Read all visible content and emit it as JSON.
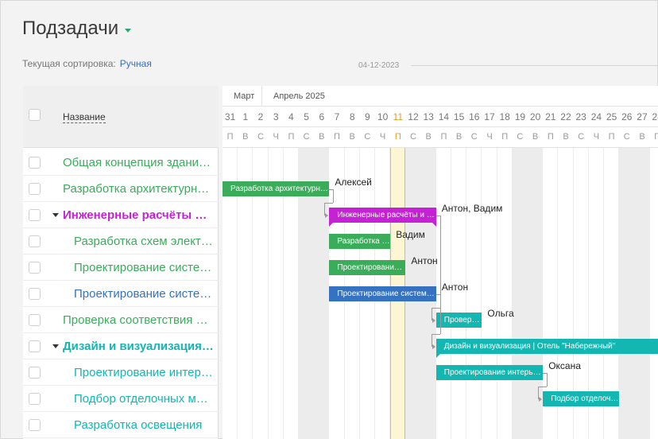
{
  "page": {
    "title": "Подзадачи"
  },
  "sort": {
    "label": "Текущая сортировка:",
    "value": "Ручная"
  },
  "timeline_date": "04-12-2023",
  "colors": {
    "green": "#3aac5a",
    "magenta": "#c522d6",
    "blue": "#3572c1",
    "teal": "#14b6b2",
    "link": "#3b6fb6"
  },
  "table": {
    "column_name": "Название",
    "rows": [
      {
        "name": "Общая концепция здания и инженерные решения",
        "color": "#3aac5a",
        "bold": false,
        "indent": 1,
        "expandable": false
      },
      {
        "name": "Разработка архитектурных решений",
        "color": "#3aac5a",
        "bold": false,
        "indent": 1,
        "expandable": false
      },
      {
        "name": "Инженерные расчёты и проектирование",
        "color": "#c522d6",
        "bold": true,
        "indent": 1,
        "expandable": true
      },
      {
        "name": "Разработка схем электроснабжения",
        "color": "#3aac5a",
        "bold": false,
        "indent": 2,
        "expandable": false
      },
      {
        "name": "Проектирование систем вентиляции",
        "color": "#3aac5a",
        "bold": false,
        "indent": 2,
        "expandable": false
      },
      {
        "name": "Проектирование систем водоснабжения",
        "color": "#3572c1",
        "bold": false,
        "indent": 2,
        "expandable": false
      },
      {
        "name": "Проверка соответствия нормам",
        "color": "#3aac5a",
        "bold": false,
        "indent": 1,
        "expandable": false
      },
      {
        "name": "Дизайн и визуализация | Отель \"Набережный\"",
        "color": "#14b6b2",
        "bold": true,
        "indent": 1,
        "expandable": true
      },
      {
        "name": "Проектирование интерьеров",
        "color": "#14b6b2",
        "bold": false,
        "indent": 2,
        "expandable": false
      },
      {
        "name": "Подбор отделочных материалов",
        "color": "#14b6b2",
        "bold": false,
        "indent": 2,
        "expandable": false
      },
      {
        "name": "Разработка освещения",
        "color": "#14b6b2",
        "bold": false,
        "indent": 2,
        "expandable": false
      }
    ]
  },
  "gantt": {
    "months": [
      "Март",
      "Апрель 2025"
    ],
    "days": [
      {
        "num": "31",
        "wd": "П",
        "weekend": false,
        "today": false
      },
      {
        "num": "1",
        "wd": "В",
        "weekend": false,
        "today": false
      },
      {
        "num": "2",
        "wd": "С",
        "weekend": false,
        "today": false
      },
      {
        "num": "3",
        "wd": "Ч",
        "weekend": false,
        "today": false
      },
      {
        "num": "4",
        "wd": "П",
        "weekend": false,
        "today": false
      },
      {
        "num": "5",
        "wd": "С",
        "weekend": true,
        "today": false
      },
      {
        "num": "6",
        "wd": "В",
        "weekend": true,
        "today": false
      },
      {
        "num": "7",
        "wd": "П",
        "weekend": false,
        "today": false
      },
      {
        "num": "8",
        "wd": "В",
        "weekend": false,
        "today": false
      },
      {
        "num": "9",
        "wd": "С",
        "weekend": false,
        "today": false
      },
      {
        "num": "10",
        "wd": "Ч",
        "weekend": false,
        "today": false
      },
      {
        "num": "11",
        "wd": "П",
        "weekend": false,
        "today": true
      },
      {
        "num": "12",
        "wd": "С",
        "weekend": true,
        "today": false
      },
      {
        "num": "13",
        "wd": "В",
        "weekend": true,
        "today": false
      },
      {
        "num": "14",
        "wd": "П",
        "weekend": false,
        "today": false
      },
      {
        "num": "15",
        "wd": "В",
        "weekend": false,
        "today": false
      },
      {
        "num": "16",
        "wd": "С",
        "weekend": false,
        "today": false
      },
      {
        "num": "17",
        "wd": "Ч",
        "weekend": false,
        "today": false
      },
      {
        "num": "18",
        "wd": "П",
        "weekend": false,
        "today": false
      },
      {
        "num": "19",
        "wd": "С",
        "weekend": true,
        "today": false
      },
      {
        "num": "20",
        "wd": "В",
        "weekend": true,
        "today": false
      },
      {
        "num": "21",
        "wd": "П",
        "weekend": false,
        "today": false
      },
      {
        "num": "22",
        "wd": "В",
        "weekend": false,
        "today": false
      },
      {
        "num": "23",
        "wd": "С",
        "weekend": false,
        "today": false
      },
      {
        "num": "24",
        "wd": "Ч",
        "weekend": false,
        "today": false
      },
      {
        "num": "25",
        "wd": "П",
        "weekend": false,
        "today": false
      },
      {
        "num": "26",
        "wd": "С",
        "weekend": true,
        "today": false
      },
      {
        "num": "27",
        "wd": "В",
        "weekend": true,
        "today": false
      },
      {
        "num": "28",
        "wd": "П",
        "weekend": false,
        "today": false
      }
    ],
    "bars": [
      {
        "row": 1,
        "start": 0,
        "days": 7,
        "color": "green",
        "label": "Разработка архитектурных решений",
        "assignee": "Алексей",
        "summary": false
      },
      {
        "row": 2,
        "start": 7,
        "days": 7,
        "color": "magenta",
        "label": "Инженерные расчёты и проектирование",
        "assignee": "Антон, Вадим",
        "summary": true
      },
      {
        "row": 3,
        "start": 7,
        "days": 4,
        "color": "green",
        "label": "Разработка схем электроснабжения",
        "assignee": "Вадим",
        "summary": false
      },
      {
        "row": 4,
        "start": 7,
        "days": 5,
        "color": "green",
        "label": "Проектирование систем вентиляции",
        "assignee": "Антон",
        "summary": false
      },
      {
        "row": 5,
        "start": 7,
        "days": 7,
        "color": "blue",
        "label": "Проектирование систем водоснабжения",
        "assignee": "Антон",
        "summary": false
      },
      {
        "row": 6,
        "start": 14,
        "days": 3,
        "color": "teal",
        "label": "Проверка соответствия нормам",
        "assignee": "Ольга",
        "summary": false
      },
      {
        "row": 7,
        "start": 14,
        "days": 15,
        "color": "teal",
        "label": "Дизайн и визуализация | Отель \"Набережный\"",
        "assignee": "",
        "summary": true
      },
      {
        "row": 8,
        "start": 14,
        "days": 7,
        "color": "teal",
        "label": "Проектирование интерьеров",
        "assignee": "Оксана",
        "summary": false
      },
      {
        "row": 9,
        "start": 21,
        "days": 5,
        "color": "teal",
        "label": "Подбор отделочных материалов",
        "assignee": "",
        "summary": false
      }
    ]
  }
}
